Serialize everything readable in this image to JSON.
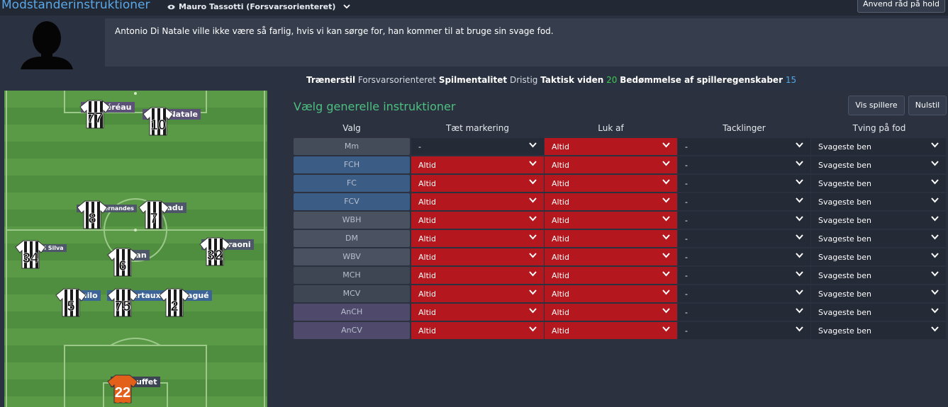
{
  "header": {
    "title": "Modstanderinstruktioner",
    "coach_name": "Mauro Tassotti (Forsvarsorienteret)",
    "apply_button": "Anvend råd på hold"
  },
  "advice": {
    "text": "Antonio Di Natale ville ikke være så farlig, hvis vi kan sørge for, han kommer til at bruge sin svage fod."
  },
  "stats": {
    "coaching_style_label": "Trænerstil",
    "coaching_style_value": "Forsvarsorienteret",
    "mentality_label": "Spilmentalitet",
    "mentality_value": "Dristig",
    "tactical_label": "Taktisk viden",
    "tactical_value": "20",
    "judging_label": "Bedømmelse af spilleregenskaber",
    "judging_value": "15"
  },
  "pitch": {
    "players": [
      {
        "number": "77",
        "name": "C. Théréau",
        "tag": "purple"
      },
      {
        "number": "10",
        "name": "A. Di Natale",
        "tag": "purple"
      },
      {
        "number": "8",
        "name": "Bruno Fernandes",
        "tag": "slate"
      },
      {
        "number": "7",
        "name": "E. Badu",
        "tag": "slate"
      },
      {
        "number": "34",
        "name": "Gabriel Silva",
        "tag": "slate"
      },
      {
        "number": "6",
        "name": "Allan",
        "tag": "slate"
      },
      {
        "number": "32",
        "name": "M. Faraoni",
        "tag": "slate"
      },
      {
        "number": "5",
        "name": "Danilo",
        "tag": "blue"
      },
      {
        "number": "75",
        "name": "T. Heurtaux",
        "tag": "blue"
      },
      {
        "number": "2",
        "name": "M. Wagué",
        "tag": "blue"
      },
      {
        "number": "22",
        "name": "O. Scuffet",
        "tag": "orange"
      }
    ]
  },
  "panel": {
    "title": "Vælg generelle instruktioner",
    "show_players_button": "Vis spillere",
    "reset_button": "Nulstil",
    "columns": [
      "Valg",
      "Tæt markering",
      "Luk af",
      "Tacklinger",
      "Tving på fod"
    ],
    "rows": [
      {
        "position": "Mm",
        "close_marking": "-",
        "close_down": "Altid",
        "tackling": "-",
        "show_onto_foot": "Svageste ben"
      },
      {
        "position": "FCH",
        "close_marking": "Altid",
        "close_down": "Altid",
        "tackling": "-",
        "show_onto_foot": "Svageste ben"
      },
      {
        "position": "FC",
        "close_marking": "Altid",
        "close_down": "Altid",
        "tackling": "-",
        "show_onto_foot": "Svageste ben"
      },
      {
        "position": "FCV",
        "close_marking": "Altid",
        "close_down": "Altid",
        "tackling": "-",
        "show_onto_foot": "Svageste ben"
      },
      {
        "position": "WBH",
        "close_marking": "Altid",
        "close_down": "Altid",
        "tackling": "-",
        "show_onto_foot": "Svageste ben"
      },
      {
        "position": "DM",
        "close_marking": "Altid",
        "close_down": "Altid",
        "tackling": "-",
        "show_onto_foot": "Svageste ben"
      },
      {
        "position": "WBV",
        "close_marking": "Altid",
        "close_down": "Altid",
        "tackling": "-",
        "show_onto_foot": "Svageste ben"
      },
      {
        "position": "MCH",
        "close_marking": "Altid",
        "close_down": "Altid",
        "tackling": "-",
        "show_onto_foot": "Svageste ben"
      },
      {
        "position": "MCV",
        "close_marking": "Altid",
        "close_down": "Altid",
        "tackling": "-",
        "show_onto_foot": "Svageste ben"
      },
      {
        "position": "AnCH",
        "close_marking": "Altid",
        "close_down": "Altid",
        "tackling": "-",
        "show_onto_foot": "Svageste ben"
      },
      {
        "position": "AnCV",
        "close_marking": "Altid",
        "close_down": "Altid",
        "tackling": "-",
        "show_onto_foot": "Svageste ben"
      }
    ]
  },
  "colors": {
    "title_blue": "#5aa8e6",
    "panel_green": "#4cc080",
    "red_select": "#b4171d",
    "pitch_green": "#4f8e3f"
  },
  "icons": {
    "eye": "eye-icon",
    "chevron": "chevron-down-icon",
    "avatar": "silhouette-avatar"
  }
}
